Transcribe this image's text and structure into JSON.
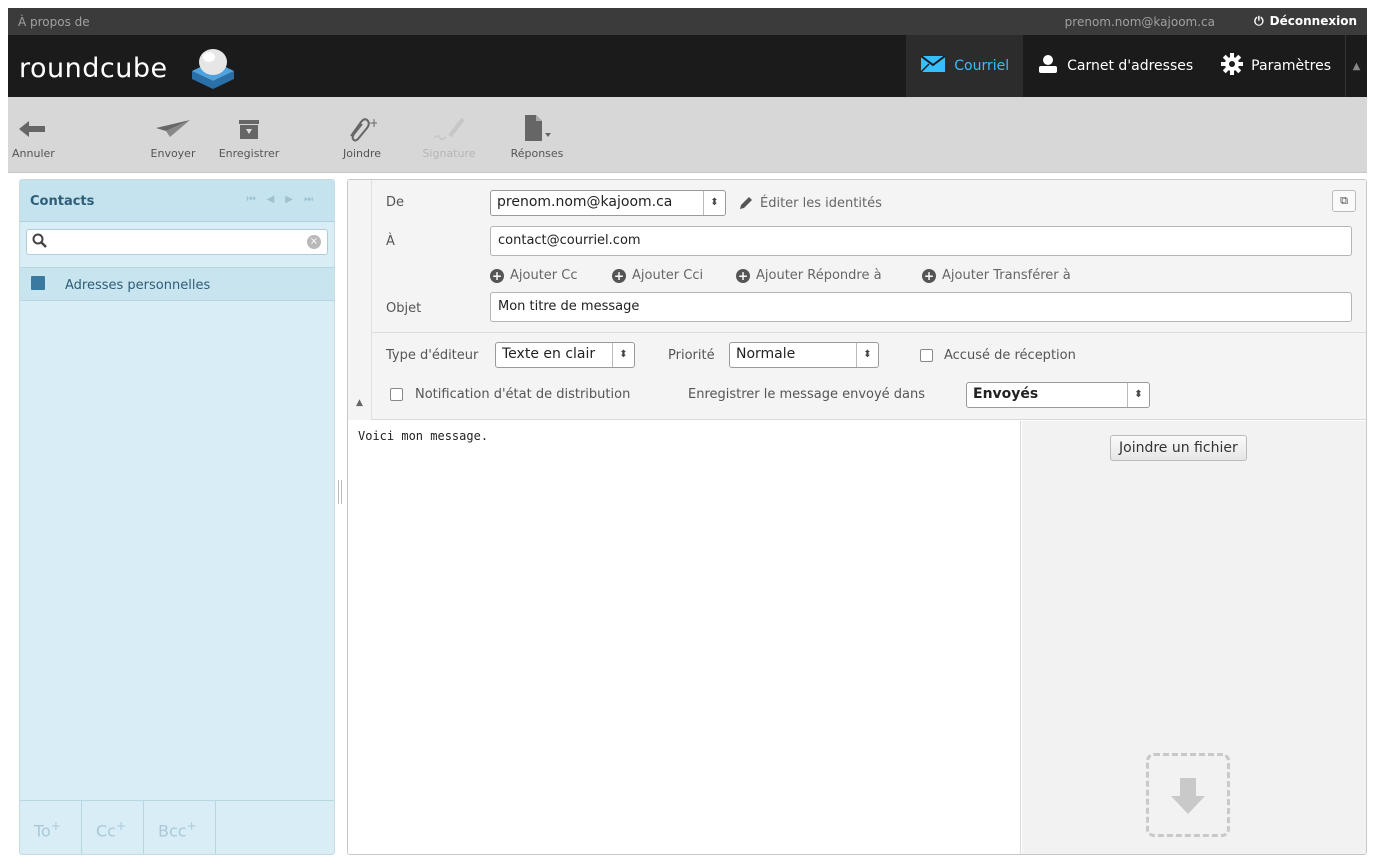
{
  "topbar": {
    "about": "À propos de",
    "user_email": "prenom.nom@kajoom.ca",
    "logout": "Déconnexion"
  },
  "header": {
    "logo": "roundcube",
    "nav": [
      {
        "label": "Courriel",
        "icon": "envelope-icon",
        "active": true
      },
      {
        "label": "Carnet d'adresses",
        "icon": "person-icon",
        "active": false
      },
      {
        "label": "Paramètres",
        "icon": "gear-icon",
        "active": false
      }
    ]
  },
  "toolbar": {
    "cancel": "Annuler",
    "send": "Envoyer",
    "save": "Enregistrer",
    "attach": "Joindre",
    "signature": "Signature",
    "responses": "Réponses"
  },
  "contacts": {
    "title": "Contacts",
    "search_value": "",
    "addressbook": "Adresses personnelles",
    "to_btn": "To",
    "cc_btn": "Cc",
    "bcc_btn": "Bcc"
  },
  "compose": {
    "from_label": "De",
    "from_value": "prenom.nom@kajoom.ca",
    "edit_identities": "Éditer les identités",
    "to_label": "À",
    "to_value": "contact@courriel.com",
    "add_cc": "Ajouter Cc",
    "add_bcc": "Ajouter Cci",
    "add_replyto": "Ajouter Répondre à",
    "add_followupto": "Ajouter Transférer à",
    "subject_label": "Objet",
    "subject_value": "Mon titre de message",
    "editor_type_label": "Type d'éditeur",
    "editor_type_value": "Texte en clair",
    "priority_label": "Priorité",
    "priority_value": "Normale",
    "mdn_label": "Accusé de réception",
    "dsn_label": "Notification d'état de distribution",
    "store_label": "Enregistrer le message envoyé dans",
    "store_value": "Envoyés",
    "body": "Voici mon message.",
    "attach_button": "Joindre un fichier"
  },
  "colors": {
    "header_bg": "#1b1b1b",
    "active_nav": "#37beff",
    "contacts_bg": "#d9edf6",
    "contacts_title": "#2e5d77"
  }
}
